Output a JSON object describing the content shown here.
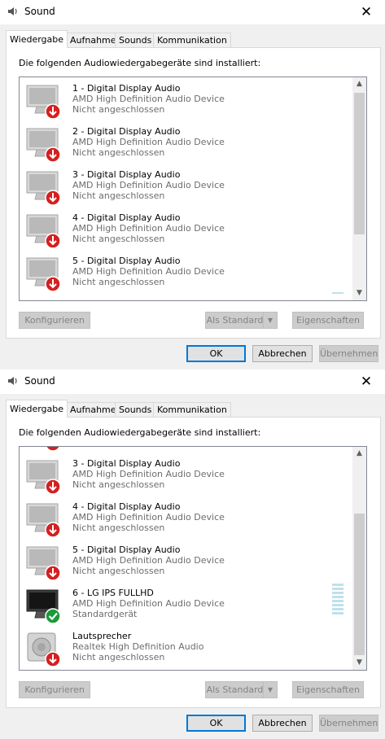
{
  "dialogs": [
    {
      "title": "Sound",
      "tabs": [
        {
          "label": "Wiedergabe",
          "active": true
        },
        {
          "label": "Aufnahme",
          "active": false
        },
        {
          "label": "Sounds",
          "active": false
        },
        {
          "label": "Kommunikation",
          "active": false
        }
      ],
      "intro": "Die folgenden Audiowiedergabegeräte sind installiert:",
      "scroll_position": "top",
      "devices": [
        {
          "name": "1 - Digital Display Audio",
          "driver": "AMD High Definition Audio Device",
          "status": "Nicht angeschlossen",
          "icon": "monitor-disconnected-icon"
        },
        {
          "name": "2 - Digital Display Audio",
          "driver": "AMD High Definition Audio Device",
          "status": "Nicht angeschlossen",
          "icon": "monitor-disconnected-icon"
        },
        {
          "name": "3 - Digital Display Audio",
          "driver": "AMD High Definition Audio Device",
          "status": "Nicht angeschlossen",
          "icon": "monitor-disconnected-icon"
        },
        {
          "name": "4 - Digital Display Audio",
          "driver": "AMD High Definition Audio Device",
          "status": "Nicht angeschlossen",
          "icon": "monitor-disconnected-icon"
        },
        {
          "name": "5 - Digital Display Audio",
          "driver": "AMD High Definition Audio Device",
          "status": "Nicht angeschlossen",
          "icon": "monitor-disconnected-icon"
        }
      ],
      "buttons": {
        "configure": "Konfigurieren",
        "set_default": "Als Standard",
        "properties": "Eigenschaften",
        "ok": "OK",
        "cancel": "Abbrechen",
        "apply": "Übernehmen"
      }
    },
    {
      "title": "Sound",
      "tabs": [
        {
          "label": "Wiedergabe",
          "active": true
        },
        {
          "label": "Aufnahme",
          "active": false
        },
        {
          "label": "Sounds",
          "active": false
        },
        {
          "label": "Kommunikation",
          "active": false
        }
      ],
      "intro": "Die folgenden Audiowiedergabegeräte sind installiert:",
      "scroll_position": "bottom",
      "devices": [
        {
          "name": "3 - Digital Display Audio",
          "driver": "AMD High Definition Audio Device",
          "status": "Nicht angeschlossen",
          "icon": "monitor-disconnected-icon"
        },
        {
          "name": "4 - Digital Display Audio",
          "driver": "AMD High Definition Audio Device",
          "status": "Nicht angeschlossen",
          "icon": "monitor-disconnected-icon"
        },
        {
          "name": "5 - Digital Display Audio",
          "driver": "AMD High Definition Audio Device",
          "status": "Nicht angeschlossen",
          "icon": "monitor-disconnected-icon"
        },
        {
          "name": "6 - LG IPS FULLHD",
          "driver": "AMD High Definition Audio Device",
          "status": "Standardgerät",
          "icon": "monitor-default-icon"
        },
        {
          "name": "Lautsprecher",
          "driver": "Realtek High Definition Audio",
          "status": "Nicht angeschlossen",
          "icon": "speaker-disconnected-icon"
        }
      ],
      "buttons": {
        "configure": "Konfigurieren",
        "set_default": "Als Standard",
        "properties": "Eigenschaften",
        "ok": "OK",
        "cancel": "Abbrechen",
        "apply": "Übernehmen"
      }
    }
  ],
  "colors": {
    "accent": "#0078d7",
    "disconnected_badge": "#d42020",
    "default_badge": "#1a9a3a",
    "level_meter": "#bfe0ec"
  }
}
